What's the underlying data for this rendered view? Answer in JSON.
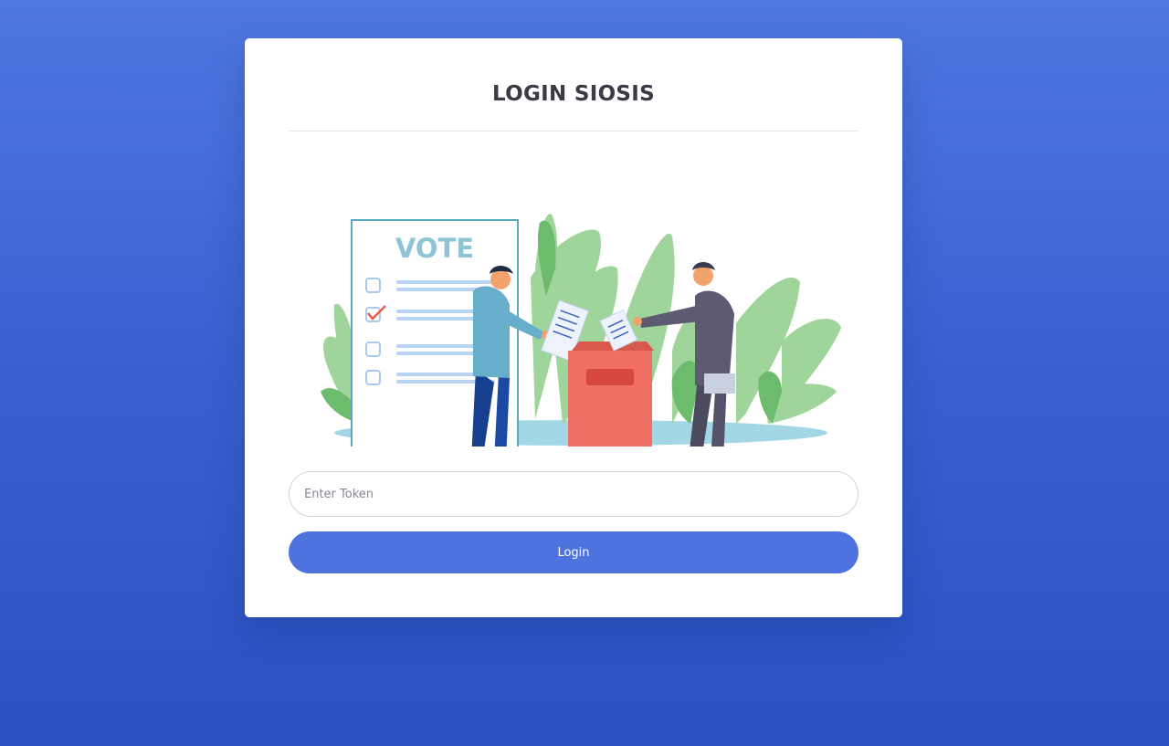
{
  "login": {
    "title": "LOGIN SIOSIS",
    "token_placeholder": "Enter Token",
    "login_label": "Login"
  },
  "illustration": {
    "board_heading": "VOTE"
  },
  "colors": {
    "background": "#4a70dc",
    "accent": "#4e73df",
    "card": "#ffffff",
    "ballot_box": "#f06f65"
  }
}
